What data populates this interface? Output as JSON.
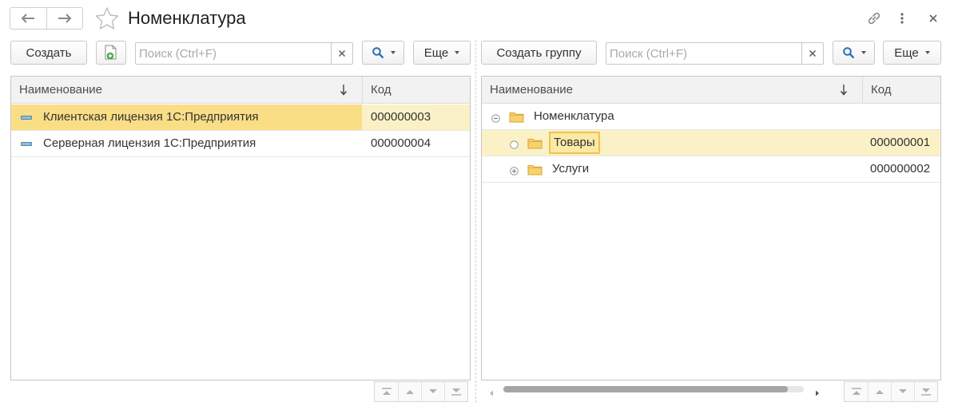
{
  "window": {
    "title": "Номенклатура"
  },
  "left": {
    "create_label": "Создать",
    "search_placeholder": "Поиск (Ctrl+F)",
    "more_label": "Еще",
    "columns": {
      "name": "Наименование",
      "code": "Код"
    },
    "rows": [
      {
        "name": "Клиентская лицензия 1С:Предприятия",
        "code": "000000003"
      },
      {
        "name": "Серверная лицензия 1С:Предприятия",
        "code": "000000004"
      }
    ]
  },
  "right": {
    "create_group_label": "Создать группу",
    "search_placeholder": "Поиск (Ctrl+F)",
    "more_label": "Еще",
    "columns": {
      "name": "Наименование",
      "code": "Код"
    },
    "root": {
      "name": "Номенклатура"
    },
    "rows": [
      {
        "name": "Товары",
        "code": "000000001"
      },
      {
        "name": "Услуги",
        "code": "000000002"
      }
    ]
  },
  "colors": {
    "selected_row": "#fbf1c6",
    "selected_cell": "#f9de86",
    "folder": "#f2c24e",
    "header_bg": "#f2f2f2",
    "add_icon_green": "#3aa53a",
    "search_icon_blue": "#2a6db4"
  },
  "icons": {
    "back": "arrow-left-icon",
    "forward": "arrow-right-icon",
    "favorite": "star-icon",
    "link": "link-icon",
    "menu": "more-vertical-icon",
    "close": "close-icon"
  }
}
